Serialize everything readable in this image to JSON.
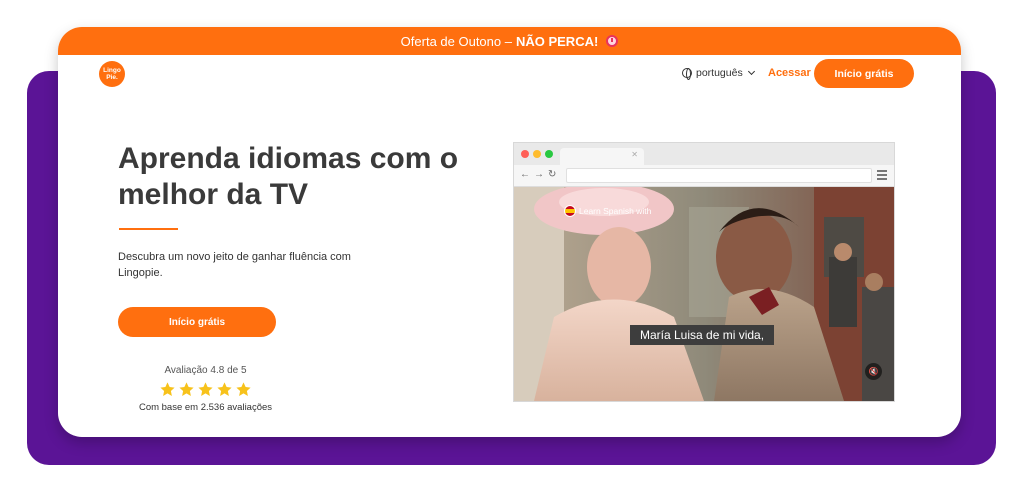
{
  "promo": {
    "text": "Oferta de Outono –",
    "bold": "NÃO PERCA!"
  },
  "nav": {
    "logo_line1": "Lingo",
    "logo_line2": "Pie.",
    "language": "português",
    "login": "Acessar",
    "cta": "Início grátis"
  },
  "hero": {
    "title": "Aprenda idiomas com o melhor da TV",
    "subtitle": "Descubra um novo jeito de ganhar fluência com Lingopie.",
    "cta": "Início grátis"
  },
  "rating": {
    "label": "Avaliação 4.8 de 5",
    "stars": 5,
    "count_text": "Com base em 2.536 avaliações"
  },
  "video": {
    "badge": "Learn Spanish with",
    "subtitle": "María Luisa de mi vida,"
  },
  "colors": {
    "accent": "#ff6f0f",
    "purple": "#5b1496",
    "star": "#f7c21b"
  }
}
